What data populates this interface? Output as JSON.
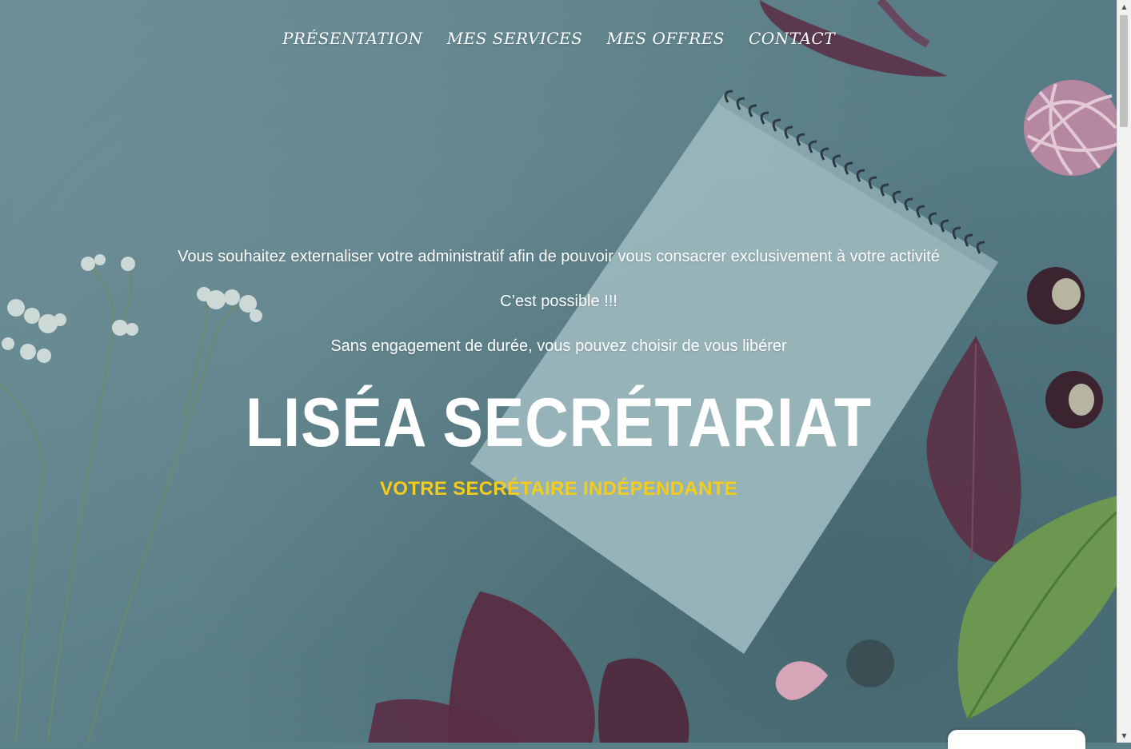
{
  "nav": {
    "items": [
      {
        "label": "PRÉSENTATION"
      },
      {
        "label": "MES SERVICES"
      },
      {
        "label": "MES OFFRES"
      },
      {
        "label": "CONTACT"
      }
    ]
  },
  "hero": {
    "line1": "Vous souhaitez externaliser votre administratif afin de pouvoir vous consacrer exclusivement à votre activité",
    "line2": "C’est possible !!!",
    "line3": "Sans engagement de durée, vous pouvez choisir de vous libérer",
    "title": "LISÉA SECRÉTARIAT",
    "subtitle": "VOTRE SECRÉTAIRE INDÉPENDANTE"
  },
  "colors": {
    "background": "#5b7f88",
    "accent": "#f4cc1a",
    "text": "#ffffff"
  },
  "icons": {
    "scroll_up": "scroll-up-icon",
    "scroll_down": "scroll-down-icon"
  }
}
